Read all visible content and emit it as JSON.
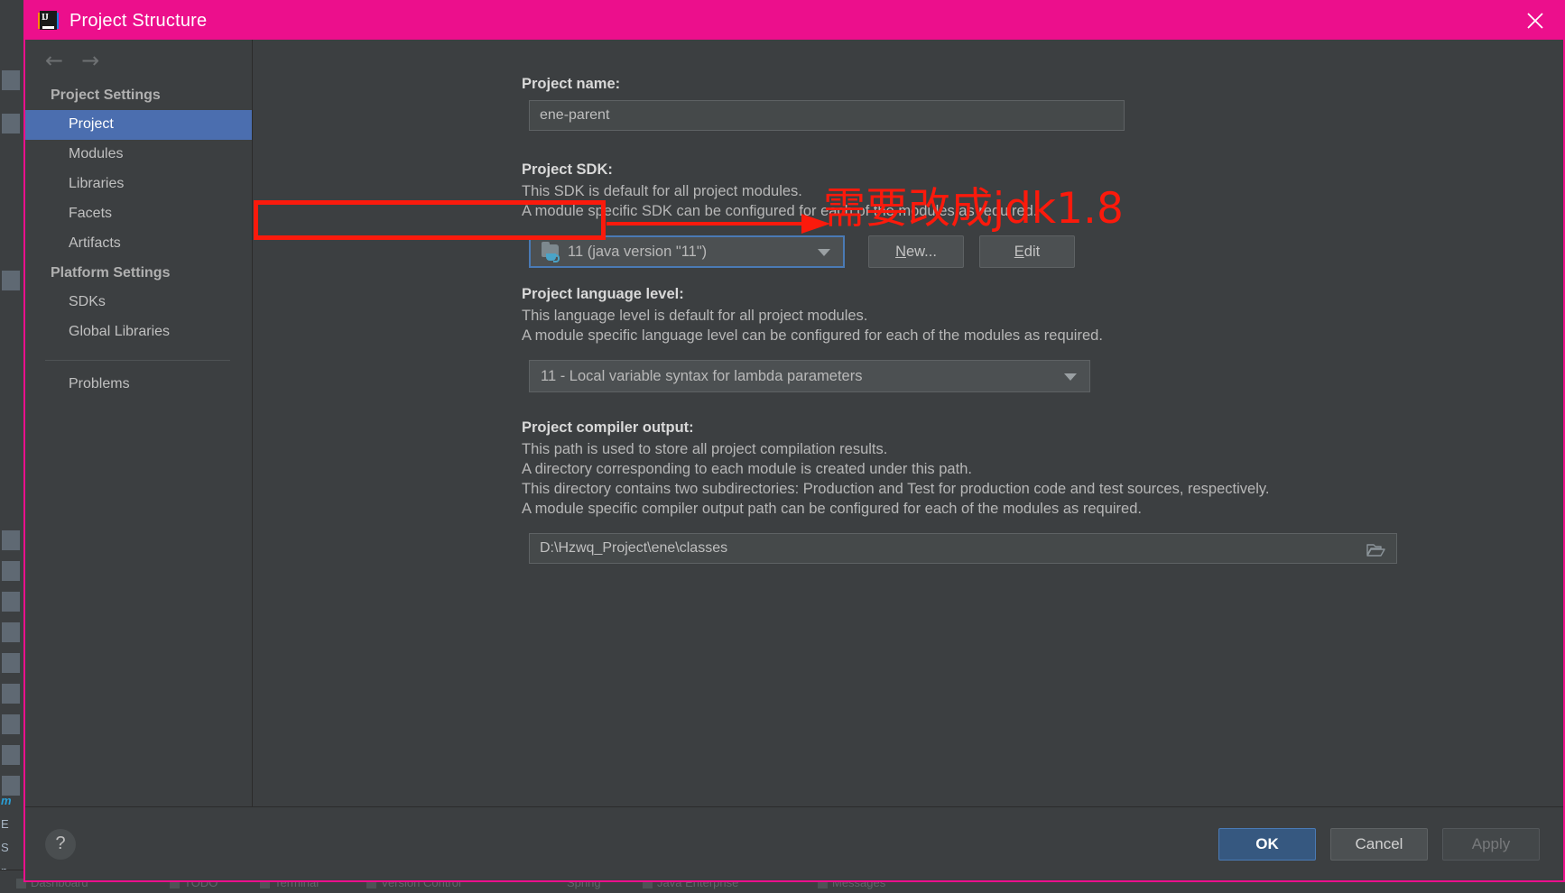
{
  "window": {
    "title": "Project Structure",
    "app_icon": "intellij-idea-icon",
    "icon_letters": "IJ",
    "close_icon": "close-icon",
    "titlebar_color": "#ec0f8c"
  },
  "sidebar": {
    "back_arrow": "←",
    "forward_arrow": "→",
    "groups": [
      {
        "title": "Project Settings",
        "items": [
          {
            "label": "Project",
            "selected": true
          },
          {
            "label": "Modules",
            "selected": false
          },
          {
            "label": "Libraries",
            "selected": false
          },
          {
            "label": "Facets",
            "selected": false
          },
          {
            "label": "Artifacts",
            "selected": false
          }
        ]
      },
      {
        "title": "Platform Settings",
        "items": [
          {
            "label": "SDKs",
            "selected": false
          },
          {
            "label": "Global Libraries",
            "selected": false
          }
        ]
      }
    ],
    "extra_items": [
      {
        "label": "Problems",
        "selected": false
      }
    ],
    "selected_color": "#4b6eaf"
  },
  "content": {
    "project_name": {
      "label": "Project name:",
      "value": "ene-parent"
    },
    "project_sdk": {
      "label": "Project SDK:",
      "desc1": "This SDK is default for all project modules.",
      "desc2": "A module specific SDK can be configured for each of the modules as required.",
      "selected": "11 (java version \"11\")",
      "sdk_icon": "jdk-folder-icon",
      "dropdown_icon": "chevron-down-icon",
      "new_button": "New...",
      "new_button_mnemonic": "N",
      "edit_button": "Edit",
      "edit_button_mnemonic": "E"
    },
    "language_level": {
      "label": "Project language level:",
      "desc1": "This language level is default for all project modules.",
      "desc2": "A module specific language level can be configured for each of the modules as required.",
      "selected": "11 - Local variable syntax for lambda parameters",
      "dropdown_icon": "chevron-down-icon"
    },
    "compiler_output": {
      "label": "Project compiler output:",
      "desc1": "This path is used to store all project compilation results.",
      "desc2": "A directory corresponding to each module is created under this path.",
      "desc3": "This directory contains two subdirectories: Production and Test for production code and test sources, respectively.",
      "desc4": "A module specific compiler output path can be configured for each of the modules as required.",
      "value": "D:\\Hzwq_Project\\ene\\classes",
      "browse_icon": "folder-browse-icon"
    }
  },
  "footer": {
    "help_label": "?",
    "ok_label": "OK",
    "cancel_label": "Cancel",
    "apply_label": "Apply",
    "ok_color": "#365880"
  },
  "annotation": {
    "text": "需要改成jdk1.8",
    "color": "#fb1a0c",
    "box_target": "project-sdk-combo",
    "arrow": "red-arrow-pointing-right"
  },
  "background": {
    "left_labels": [
      "E",
      "S",
      "n"
    ],
    "italic_label": "m",
    "bottom_items": [
      "Dashboard",
      "TODO",
      "Terminal",
      "Version Control",
      "Spring",
      "Java Enterprise",
      "Messages"
    ]
  }
}
